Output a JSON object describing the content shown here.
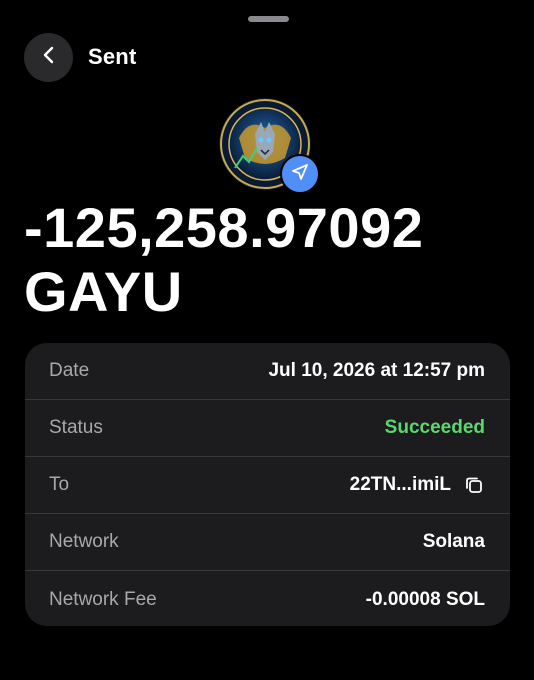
{
  "header": {
    "title": "Sent",
    "back_icon": "chevron-left-icon"
  },
  "token": {
    "logo_icon": "golden-bull-wolf-logo",
    "logo_text_top": "GOLDEN BULL",
    "logo_text_bottom": "$GAYU",
    "badge_icon": "send-arrow-icon",
    "badge_color": "#4f8ff7"
  },
  "amount": {
    "value": "-125,258.97092",
    "symbol": "GAYU"
  },
  "details": [
    {
      "label": "Date",
      "value": "Jul 10, 2026 at 12:57 pm"
    },
    {
      "label": "Status",
      "value": "Succeeded",
      "color": "#5ad86c"
    },
    {
      "label": "To",
      "value": "22TN...imiL",
      "icon": "copy-icon"
    },
    {
      "label": "Network",
      "value": "Solana"
    },
    {
      "label": "Network Fee",
      "value": "-0.00008 SOL"
    }
  ]
}
